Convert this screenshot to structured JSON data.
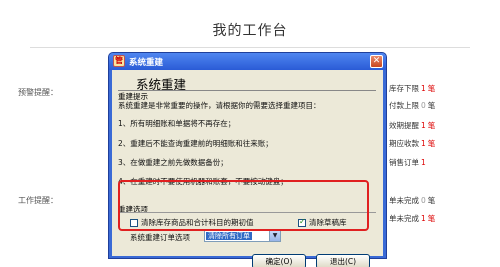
{
  "page": {
    "title": "我的工作台"
  },
  "side": {
    "warning_label": "预警提醒：",
    "work_label": "工作提醒："
  },
  "right_items": [
    {
      "label": "库存下限",
      "count": "1",
      "unit": "笔",
      "red": true
    },
    {
      "label": "付款上限",
      "count": "0",
      "unit": "笔",
      "red": false
    },
    {
      "label": "效期提醒",
      "count": "1",
      "unit": "笔",
      "red": true
    },
    {
      "label": "期应收款",
      "count": "1",
      "unit": "笔",
      "red": true
    },
    {
      "label": "销售订单",
      "count": "1",
      "unit": "",
      "red": true
    },
    {
      "label": "单未完成",
      "count": "0",
      "unit": "笔",
      "red": false
    },
    {
      "label": "单未完成",
      "count": "1",
      "unit": "笔",
      "red": true
    }
  ],
  "dialog": {
    "title": "系统重建",
    "heading": "系统重建",
    "tips_group": "重建提示",
    "tips": [
      "系统重建是非常重要的操作，请根据你的需要选择重建项目：",
      "1、所有明细账和单据将不再存在；",
      "2、重建后不能查询重建前的明细账和往来账；",
      "3、在做重建之前先做数据备份；",
      "4、在重建时不要使用机器和账套，不要按动键盘；"
    ],
    "options_group": "重建选项",
    "options": {
      "clear_init": {
        "label": "清除库存商品和合计科目的期初值",
        "checked": false
      },
      "clear_draft": {
        "label": "清除草稿库",
        "checked": true
      }
    },
    "order_option_label": "系统重建订单选项",
    "order_option_value": "清除所有订单",
    "ok_label": "确定(O)",
    "exit_label": "退出(C)"
  },
  "colors": {
    "highlight": "#e02020",
    "title_bar": "#2a5bd6",
    "count_red": "#dd0000"
  }
}
